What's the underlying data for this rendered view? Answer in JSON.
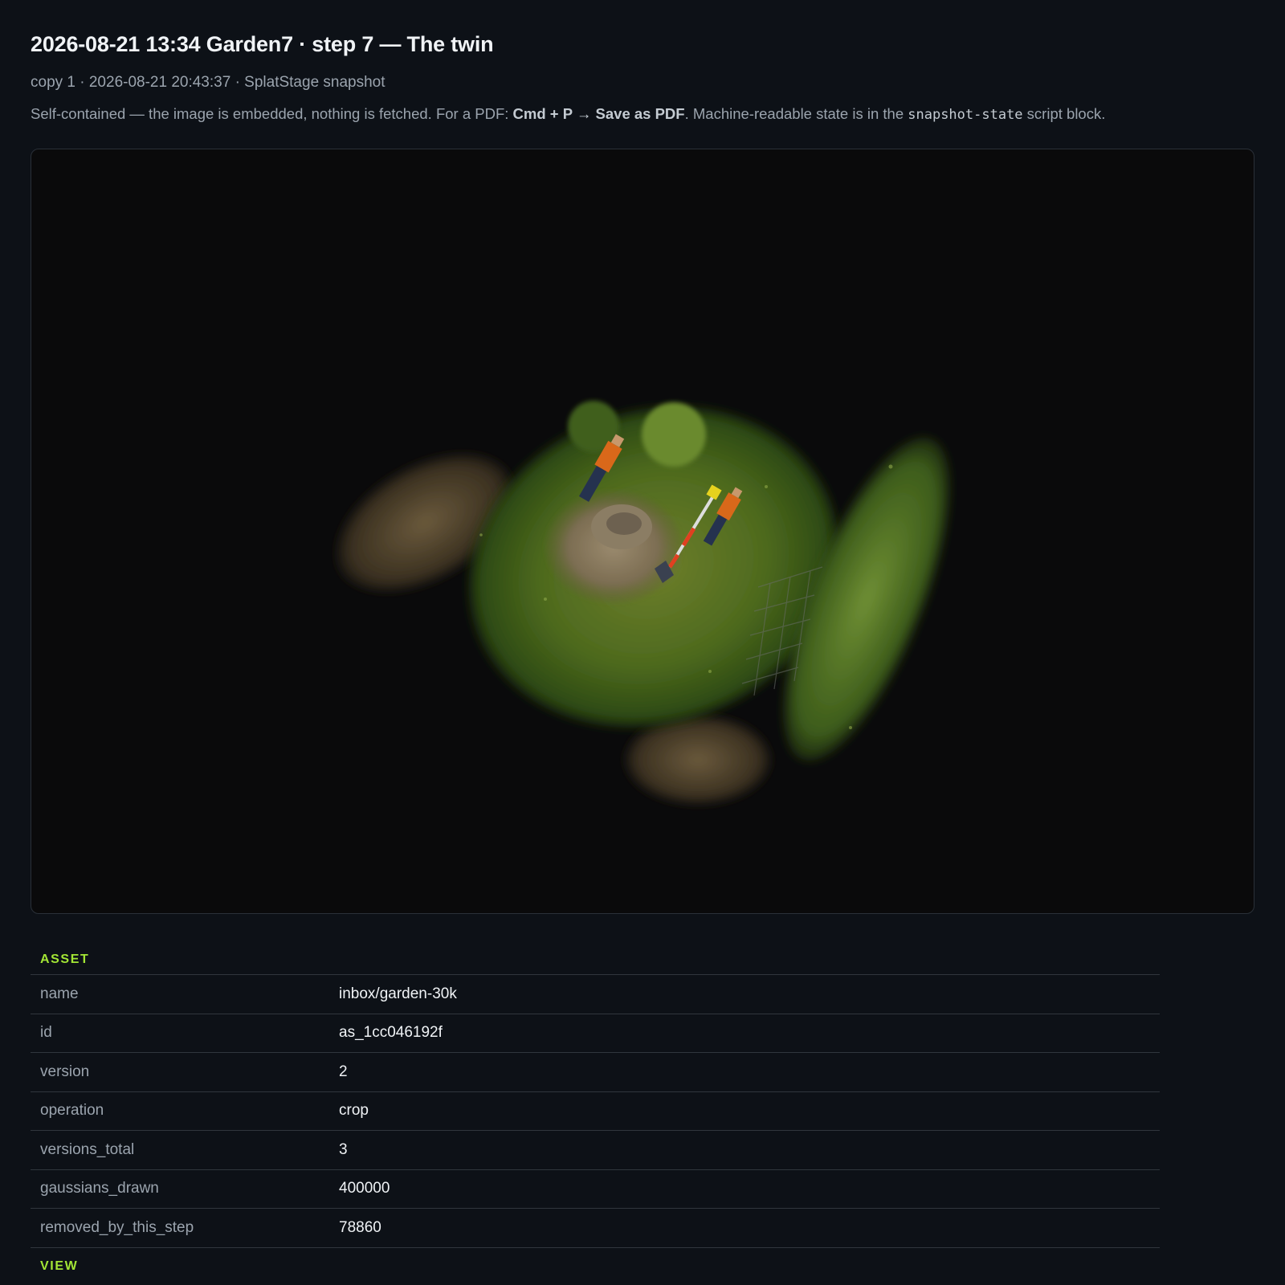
{
  "header": {
    "title": "2026-08-21 13:34 Garden7 · step 7 — The twin",
    "meta": "copy 1 · 2026-08-21 20:43:37 · SplatStage snapshot",
    "note_pre": "Self-contained — the image is embedded, nothing is fetched. For a PDF: ",
    "note_bold": "Cmd + P → Save as PDF",
    "note_mid": ". Machine-readable state is in the ",
    "note_code": "snapshot-state",
    "note_post": " script block."
  },
  "viewport": {
    "background": "#0a0a0b",
    "scene": "3d-gaussian-splat-garden"
  },
  "asset": {
    "section_label": "ASSET",
    "rows": [
      {
        "key": "name",
        "value": "inbox/garden-30k"
      },
      {
        "key": "id",
        "value": "as_1cc046192f"
      },
      {
        "key": "version",
        "value": "2"
      },
      {
        "key": "operation",
        "value": "crop"
      },
      {
        "key": "versions_total",
        "value": "3"
      },
      {
        "key": "gaussians_drawn",
        "value": "400000"
      },
      {
        "key": "removed_by_this_step",
        "value": "78860"
      }
    ]
  },
  "view": {
    "section_label": "VIEW"
  },
  "colors": {
    "accent": "#a3e635",
    "background": "#0d1117",
    "border": "#30363d"
  }
}
